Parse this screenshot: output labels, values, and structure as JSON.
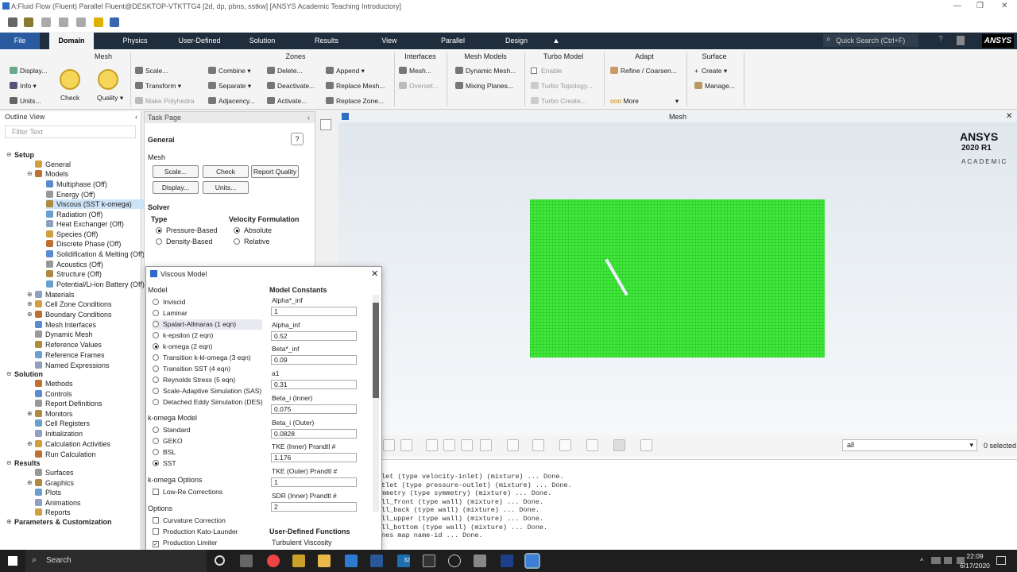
{
  "window": {
    "title": "A:Fluid Flow (Fluent) Parallel Fluent@DESKTOP-VTKTTG4  [2d, dp, pbns, sstkw] [ANSYS Academic Teaching Introductory]"
  },
  "ribbon_tabs": [
    "File",
    "Domain",
    "Physics",
    "User-Defined",
    "Solution",
    "Results",
    "View",
    "Parallel",
    "Design"
  ],
  "quick_search": "Quick Search (Ctrl+F)",
  "brand": "ANSYS",
  "ribbon": {
    "mesh": {
      "title": "Mesh",
      "display": "Display...",
      "info": "Info",
      "units": "Units...",
      "check": "Check",
      "quality": "Quality"
    },
    "zones": {
      "title": "Zones",
      "scale": "Scale...",
      "transform": "Transform",
      "make_polyhedra": "Make Polyhedra",
      "combine": "Combine",
      "separate": "Separate",
      "adjacency": "Adjacency...",
      "delete": "Delete...",
      "deactivate": "Deactivate...",
      "activate": "Activate...",
      "append": "Append",
      "replace_mesh": "Replace Mesh...",
      "replace_zone": "Replace Zone..."
    },
    "interfaces": {
      "title": "Interfaces",
      "mesh": "Mesh...",
      "overset": "Overset..."
    },
    "mesh_models": {
      "title": "Mesh Models",
      "dynamic": "Dynamic Mesh...",
      "mixing": "Mixing Planes..."
    },
    "turbo": {
      "title": "Turbo Model",
      "enable": "Enable",
      "topology": "Turbo Topology...",
      "create": "Turbo Create..."
    },
    "adapt": {
      "title": "Adapt",
      "refine": "Refine / Coarsen...",
      "more": "More"
    },
    "surface": {
      "title": "Surface",
      "create": "Create",
      "manage": "Manage..."
    }
  },
  "outline": {
    "title": "Outline View",
    "filter": "Filter Text",
    "items": [
      {
        "label": "Setup",
        "bold": true
      },
      {
        "label": "General"
      },
      {
        "label": "Models"
      },
      {
        "label": "Multiphase (Off)"
      },
      {
        "label": "Energy (Off)"
      },
      {
        "label": "Viscous (SST k-omega)",
        "selected": true
      },
      {
        "label": "Radiation (Off)"
      },
      {
        "label": "Heat Exchanger (Off)"
      },
      {
        "label": "Species (Off)"
      },
      {
        "label": "Discrete Phase (Off)"
      },
      {
        "label": "Solidification & Melting (Off)"
      },
      {
        "label": "Acoustics (Off)"
      },
      {
        "label": "Structure (Off)"
      },
      {
        "label": "Potential/Li-ion Battery (Off)"
      },
      {
        "label": "Materials"
      },
      {
        "label": "Cell Zone Conditions"
      },
      {
        "label": "Boundary Conditions"
      },
      {
        "label": "Mesh Interfaces"
      },
      {
        "label": "Dynamic Mesh"
      },
      {
        "label": "Reference Values"
      },
      {
        "label": "Reference Frames"
      },
      {
        "label": "Named Expressions"
      },
      {
        "label": "Solution",
        "bold": true
      },
      {
        "label": "Methods"
      },
      {
        "label": "Controls"
      },
      {
        "label": "Report Definitions"
      },
      {
        "label": "Monitors"
      },
      {
        "label": "Cell Registers"
      },
      {
        "label": "Initialization"
      },
      {
        "label": "Calculation Activities"
      },
      {
        "label": "Run Calculation"
      },
      {
        "label": "Results",
        "bold": true
      },
      {
        "label": "Surfaces"
      },
      {
        "label": "Graphics"
      },
      {
        "label": "Plots"
      },
      {
        "label": "Animations"
      },
      {
        "label": "Reports"
      },
      {
        "label": "Parameters & Customization",
        "bold": true
      }
    ]
  },
  "task": {
    "title": "Task Page",
    "section": "General",
    "mesh": "Mesh",
    "scale": "Scale...",
    "check": "Check",
    "report_quality": "Report Quality",
    "display": "Display...",
    "units": "Units...",
    "solver": "Solver",
    "type": "Type",
    "pressure": "Pressure-Based",
    "density": "Density-Based",
    "velocity": "Velocity Formulation",
    "absolute": "Absolute",
    "relative": "Relative"
  },
  "graphics": {
    "title": "Mesh",
    "brand_line1": "ANSYS",
    "brand_line2": "2020 R1",
    "brand_line3": "ACADEMIC",
    "filter_value": "all",
    "selected": "0 selected"
  },
  "console": [
    "let (type velocity-inlet) (mixture) ... Done.",
    "tlet (type pressure-outlet) (mixture) ... Done.",
    "mmetry (type symmetry) (mixture) ... Done.",
    "ll_front (type wall) (mixture) ... Done.",
    "ll_back (type wall) (mixture) ... Done.",
    "ll_upper (type wall) (mixture) ... Done.",
    "ll_bottom (type wall) (mixture) ... Done.",
    "nes map name-id ... Done."
  ],
  "dialog": {
    "title": "Viscous Model",
    "model": "Model",
    "models": [
      "Inviscid",
      "Laminar",
      "Spalart-Allmaras (1 eqn)",
      "k-epsilon (2 eqn)",
      "k-omega (2 eqn)",
      "Transition k-kl-omega (3 eqn)",
      "Transition SST (4 eqn)",
      "Reynolds Stress (5 eqn)",
      "Scale-Adaptive Simulation (SAS)",
      "Detached Eddy Simulation (DES)"
    ],
    "komega_model": "k-omega Model",
    "komega_types": [
      "Standard",
      "GEKO",
      "BSL",
      "SST"
    ],
    "komega_options": "k-omega Options",
    "low_re": "Low-Re Corrections",
    "options": "Options",
    "opts": [
      "Curvature Correction",
      "Production Kato-Launder",
      "Production Limiter"
    ],
    "constants_title": "Model Constants",
    "constants": [
      {
        "name": "Alpha*_inf",
        "value": "1"
      },
      {
        "name": "Alpha_inf",
        "value": "0.52"
      },
      {
        "name": "Beta*_inf",
        "value": "0.09"
      },
      {
        "name": "a1",
        "value": "0.31"
      },
      {
        "name": "Beta_i (Inner)",
        "value": "0.075"
      },
      {
        "name": "Beta_i (Outer)",
        "value": "0.0828"
      },
      {
        "name": "TKE (Inner) Prandtl #",
        "value": "1.176"
      },
      {
        "name": "TKE (Outer) Prandtl #",
        "value": "1"
      },
      {
        "name": "SDR (Inner) Prandtl #",
        "value": "2"
      }
    ],
    "udf_title": "User-Defined Functions",
    "udf_label": "Turbulent Viscosity"
  },
  "taskbar": {
    "search": "Search",
    "time": "22:09",
    "date": "6/17/2020",
    "badge": "32"
  }
}
